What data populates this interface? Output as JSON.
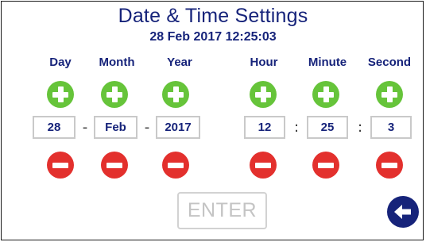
{
  "screen": {
    "title": "Date & Time Settings",
    "current_datetime": "28 Feb 2017 12:25:03"
  },
  "fields": [
    {
      "label": "Day",
      "value": "28"
    },
    {
      "label": "Month",
      "value": "Feb"
    },
    {
      "label": "Year",
      "value": "2017"
    },
    {
      "label": "Hour",
      "value": "12"
    },
    {
      "label": "Minute",
      "value": "25"
    },
    {
      "label": "Second",
      "value": "3"
    }
  ],
  "separators": {
    "date": "-",
    "time": ":"
  },
  "buttons": {
    "enter_label": "ENTER",
    "back_icon": "arrow-left-icon",
    "increment_icon": "plus-icon",
    "decrement_icon": "minus-icon"
  },
  "colors": {
    "text": "#16237a",
    "increment": "#66c43a",
    "decrement": "#e3302d",
    "enter_disabled": "#c4c4c4",
    "back_button": "#16237a"
  }
}
